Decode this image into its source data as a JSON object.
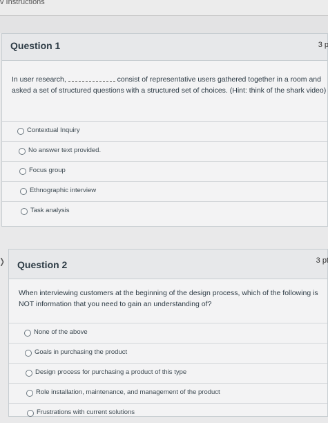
{
  "header": {
    "instructions_label": "v Instructions"
  },
  "questions": [
    {
      "title": "Question 1",
      "points": "3 p",
      "text_before": "In user research, ",
      "text_after": " consist of representative users gathered together in a room and asked a set of structured questions with a structured set of choices. (Hint: think of the shark video)",
      "answers": [
        "Contextual Inquiry",
        "No answer text provided.",
        "Focus group",
        "Ethnographic interview",
        "Task analysis"
      ]
    },
    {
      "title": "Question 2",
      "points": "3 pt",
      "text": "When interviewing customers at the beginning of the design process, which of the following is NOT information that you need to gain an understanding of?",
      "answers": [
        "None of the above",
        "Goals in purchasing the product",
        "Design process for purchasing a product of this type",
        "Role installation, maintenance, and management of the product",
        "Frustrations with current solutions"
      ]
    }
  ]
}
